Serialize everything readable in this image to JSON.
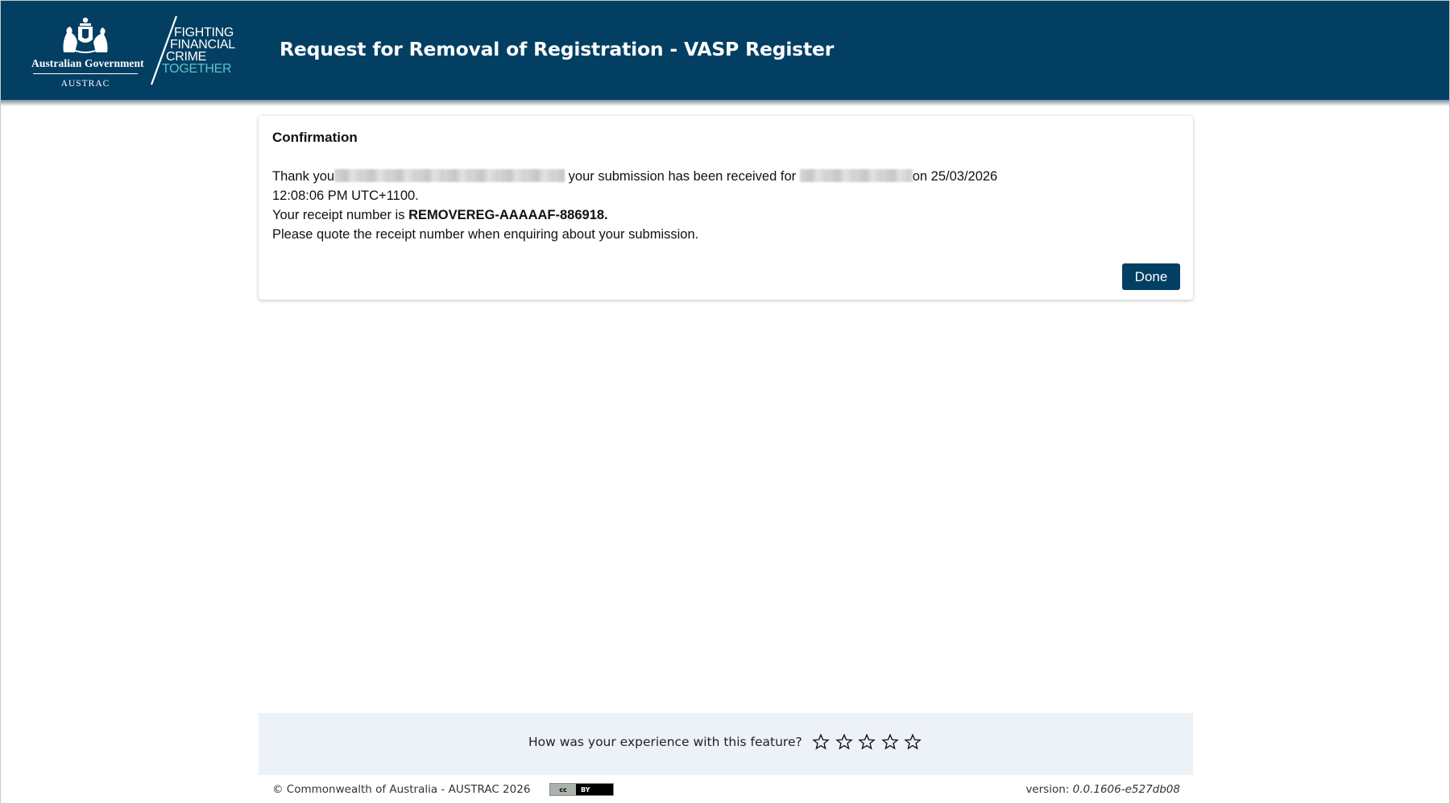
{
  "header": {
    "gov_name": "Australian Government",
    "agency": "AUSTRAC",
    "campaign_logo_lines": [
      "FIGHTING",
      "FINANCIAL",
      "CRIME",
      "TOGETHER"
    ],
    "title": "Request for Removal of Registration - VASP Register"
  },
  "confirmation": {
    "heading": "Confirmation",
    "thank_you_prefix": "Thank you",
    "received_text": "your submission has been received for",
    "date_text": "on 25/03/2026",
    "time_text": "12:08:06 PM UTC+1100.",
    "receipt_prefix": "Your receipt number is",
    "receipt_number": "REMOVEREG-AAAAAF-886918.",
    "quote_note": "Please quote the receipt number when enquiring about your submission.",
    "done_label": "Done"
  },
  "feedback": {
    "question": "How was your experience with this feature?",
    "rating": 0,
    "max_rating": 5
  },
  "footer": {
    "copyright": "© Commonwealth of Australia - AUSTRAC 2026",
    "license_badge": {
      "left": "cc",
      "right": "BY"
    },
    "version_label": "version:",
    "version_number": "0.0.1606-e527db08"
  },
  "colors": {
    "brand_navy": "#033f63",
    "accent_teal": "#5cc3c9",
    "feedback_bg": "#edf2f8"
  }
}
